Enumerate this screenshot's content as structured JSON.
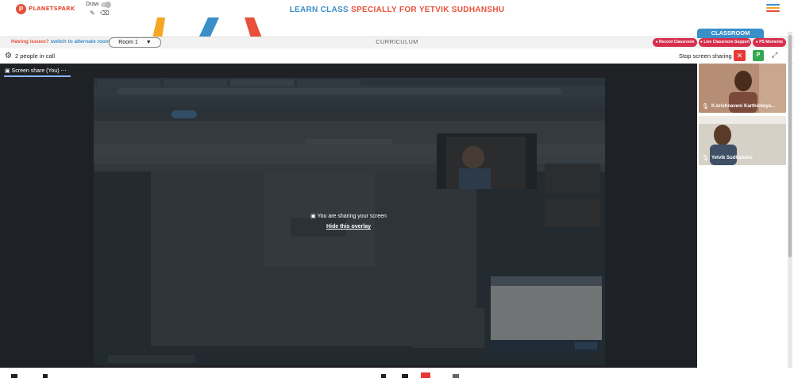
{
  "app": {
    "logo_text": "PLANETSPARK",
    "title_part1": "LEARN CLASS",
    "title_part2": "SPECIALLY FOR YETVIK SUDHANSHU",
    "draw_label": "Draw"
  },
  "bar": {
    "issues_text": "Having issues?",
    "alternate_link": "switch to alternate room",
    "room_value": "Room 1",
    "curriculum": "CURRICULUM",
    "classroom_tab": "CLASSROOM",
    "record_pill": "Record Classroom",
    "support_pill": "Live Classroom Support",
    "moments_pill": "PS Moments"
  },
  "call": {
    "people_count": "2 people in call",
    "stop_label": "Stop screen sharing",
    "p_button": "P",
    "tab_label": "Screen share (You)",
    "sharing_msg": "You are sharing your screen",
    "hide_link": "Hide this overlay"
  },
  "participants": [
    {
      "name": "K.krishnaveni Karthickeya..."
    },
    {
      "name": "Yetvik Sudhanshu"
    }
  ],
  "colors": {
    "brand_red": "#e8503a",
    "brand_blue": "#3a8fc8",
    "pill_red": "#d62f4d",
    "meet_dark": "#202124"
  }
}
